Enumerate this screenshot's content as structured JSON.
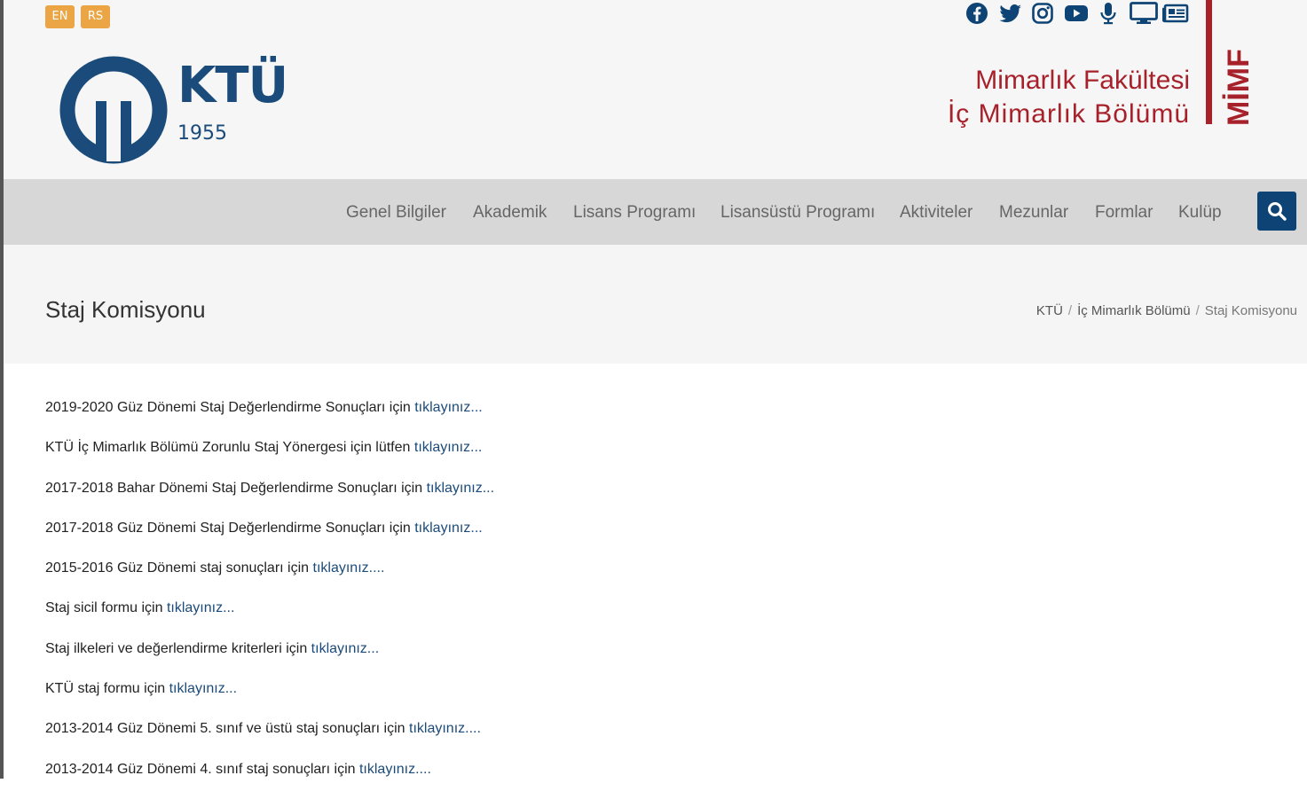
{
  "lang": {
    "en": "EN",
    "rs": "RS"
  },
  "logo": {
    "name": "KTÜ",
    "year": "1955"
  },
  "social": [
    "facebook-icon",
    "twitter-icon",
    "instagram-icon",
    "youtube-icon",
    "microphone-icon",
    "monitor-icon",
    "newspaper-icon"
  ],
  "faculty": {
    "line1": "Mimarlık Fakültesi",
    "line2": "İç Mimarlık Bölümü",
    "badge": "MİMF"
  },
  "nav": [
    "Genel Bilgiler",
    "Akademik",
    "Lisans Programı",
    "Lisansüstü Programı",
    "Aktiviteler",
    "Mezunlar",
    "Formlar",
    "Kulüp"
  ],
  "page": {
    "title": "Staj Komisyonu"
  },
  "breadcrumb": {
    "home": "KTÜ",
    "section": "İç Mimarlık Bölümü",
    "current": "Staj Komisyonu",
    "separator": "/"
  },
  "colors": {
    "accent_red": "#a7212b",
    "brand_blue": "#1b4b7a",
    "lang_orange": "#eba544",
    "search_blue": "#0e4475"
  },
  "items": [
    {
      "text": "2019-2020 Güz Dönemi Staj Değerlendirme Sonuçları için",
      "link": "tıklayınız..."
    },
    {
      "text": "KTÜ İç Mimarlık Bölümü Zorunlu Staj Yönergesi için lütfen",
      "link": "tıklayınız..."
    },
    {
      "text": "2017-2018 Bahar Dönemi Staj Değerlendirme Sonuçları için",
      "link": "tıklayınız..."
    },
    {
      "text": "2017-2018 Güz Dönemi Staj Değerlendirme Sonuçları için",
      "link": "tıklayınız..."
    },
    {
      "text": "2015-2016 Güz Dönemi staj sonuçları için",
      "link": "tıklayınız...."
    },
    {
      "text": "Staj sicil formu için",
      "link": "tıklayınız..."
    },
    {
      "text": "Staj ilkeleri ve değerlendirme kriterleri için",
      "link": "tıklayınız..."
    },
    {
      "text": "KTÜ staj formu için",
      "link": "tıklayınız..."
    },
    {
      "text": "2013-2014 Güz Dönemi 5. sınıf ve üstü staj sonuçları için",
      "link": "tıklayınız...."
    },
    {
      "text": "2013-2014 Güz Dönemi 4. sınıf staj sonuçları için",
      "link": "tıklayınız...."
    }
  ]
}
